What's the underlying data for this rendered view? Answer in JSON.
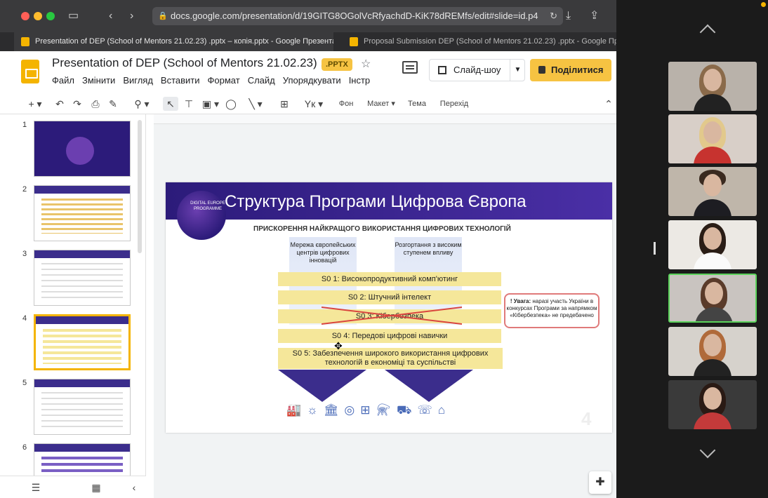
{
  "browser": {
    "url": "docs.google.com/presentation/d/19GITG8OGolVcRfyachdD-KiK78dREMfs/edit#slide=id.p4",
    "tabs": [
      {
        "label": "Presentation of DEP (School of Mentors 21.02.23) .pptx – копія.pptx - Google Презентації"
      },
      {
        "label": "Proposal Submission DEP (School of Mentors 21.02.23) .pptx - Google Презе"
      }
    ]
  },
  "docs": {
    "title": "Presentation of DEP (School of Mentors 21.02.23) ...",
    "badge": ".PPTX",
    "menu": [
      "Файл",
      "Змінити",
      "Вигляд",
      "Вставити",
      "Формат",
      "Слайд",
      "Упорядкувати",
      "Інстр"
    ],
    "slideshow_label": "Слайд-шоу",
    "share_label": "Поділитися",
    "toolbar": {
      "font_label": "Yк",
      "background": "Фон",
      "layout": "Макет",
      "theme": "Тема",
      "transition": "Перехід"
    }
  },
  "filmstrip": {
    "slide_numbers": [
      "1",
      "2",
      "3",
      "4",
      "5",
      "6"
    ],
    "selected": "4"
  },
  "slide": {
    "title": "Структура Програми Цифрова Європа",
    "logo_text": "DIGITAL EUROPE PROGRAMME",
    "subtitle": "ПРИСКОРЕННЯ НАЙКРАЩОГО ВИКОРИСТАННЯ ЦИФРОВИХ  ТЕХНОЛОГІЙ",
    "pillar_left": "Мережа європейських центрів цифрових інновацій",
    "pillar_right": "Розгортання з високим ступенем впливу",
    "rows": [
      "S0 1: Високопродуктивний комп'ютинг",
      "S0 2: Штучний інтелект",
      "S0 3: Кібербезпека",
      "S0 4: Передові цифрові навички",
      "S0 5: Забезпечення широкого використання цифрових технологій в економіці та суспільстві"
    ],
    "notice_bold": "! Увага:",
    "notice_text": "наразі участь України в конкурсах Програми за напрямком «Кібербезпека» не предебачено",
    "slide_number": "4"
  },
  "colors": {
    "brand": "#f4b400",
    "banner": "#3b2d8c",
    "highlight": "#f5e79a",
    "active_tile": "#5bd35b"
  }
}
